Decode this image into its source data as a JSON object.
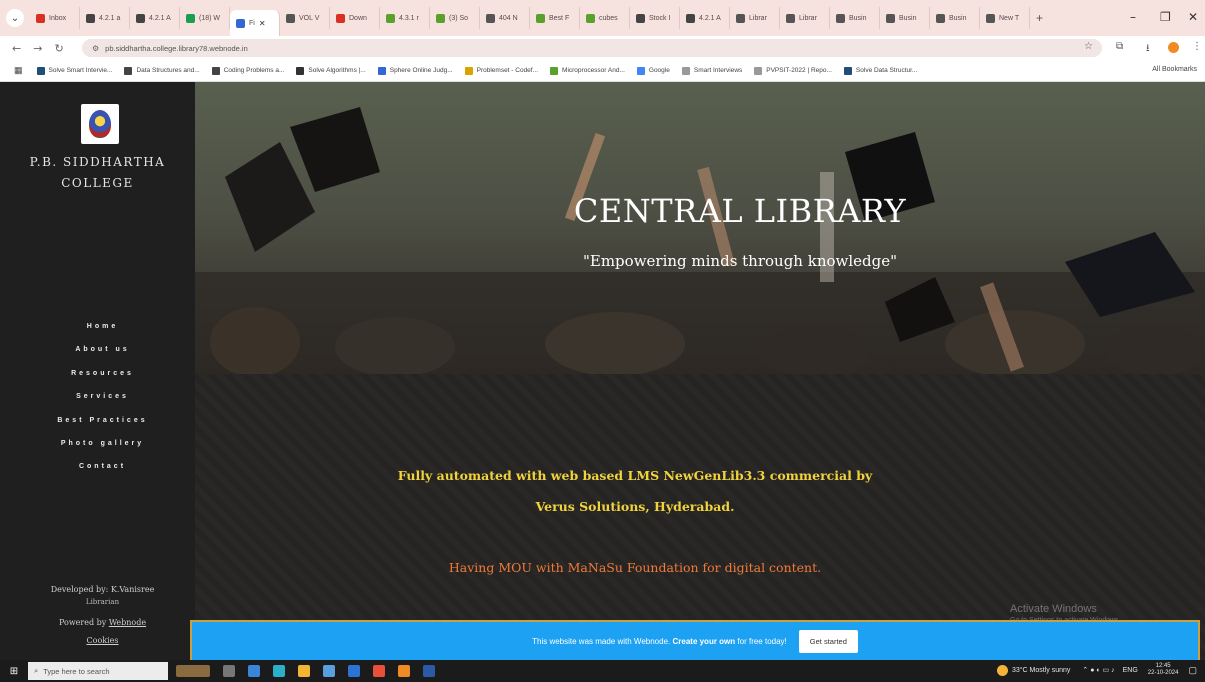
{
  "browser": {
    "tabs": [
      {
        "label": "Inbox",
        "color": "#d93025"
      },
      {
        "label": "4.2.1 a",
        "color": "#444444"
      },
      {
        "label": "4.2.1 A",
        "color": "#444444"
      },
      {
        "label": "(18) W",
        "color": "#1a9e50"
      },
      {
        "label": "Fi",
        "color": "#3367d6",
        "active": true
      },
      {
        "label": "VOL V",
        "color": "#555555"
      },
      {
        "label": "Down",
        "color": "#d93025"
      },
      {
        "label": "4.3.1 r",
        "color": "#5aa02c"
      },
      {
        "label": "(3) So",
        "color": "#5aa02c"
      },
      {
        "label": "404 N",
        "color": "#555555"
      },
      {
        "label": "Best F",
        "color": "#5aa02c"
      },
      {
        "label": "cubes",
        "color": "#5aa02c"
      },
      {
        "label": "Stock I",
        "color": "#444444"
      },
      {
        "label": "4.2.1 A",
        "color": "#444444"
      },
      {
        "label": "Librar",
        "color": "#555555"
      },
      {
        "label": "Librar",
        "color": "#555555"
      },
      {
        "label": "Busin",
        "color": "#555555"
      },
      {
        "label": "Busin",
        "color": "#555555"
      },
      {
        "label": "Busin",
        "color": "#555555"
      },
      {
        "label": "New T",
        "color": "#555555"
      }
    ],
    "url": "pb.siddhartha.college.library78.webnode.in",
    "bookmarks": [
      {
        "label": "Solve Smart Intervie...",
        "color": "#1f4e79"
      },
      {
        "label": "Data Structures and...",
        "color": "#444444"
      },
      {
        "label": "Coding Problems a...",
        "color": "#444444"
      },
      {
        "label": "Solve Algorithms |...",
        "color": "#333333"
      },
      {
        "label": "Sphere Online Judg...",
        "color": "#3367d6"
      },
      {
        "label": "Problemset - Codef...",
        "color": "#d9a400"
      },
      {
        "label": "Microprocessor And...",
        "color": "#5aa02c"
      },
      {
        "label": "Google",
        "color": "#4285f4"
      },
      {
        "label": "Smart Interviews",
        "color": "#999999"
      },
      {
        "label": "PVPSIT-2022 | Repo...",
        "color": "#999999"
      },
      {
        "label": "Solve Data Structur...",
        "color": "#1f4e79"
      }
    ],
    "all_bookmarks": "All Bookmarks"
  },
  "sidebar": {
    "college_line1": "P.B. SIDDHARTHA",
    "college_line2": "COLLEGE",
    "nav": [
      "Home",
      "About us",
      "Resources",
      "Services",
      "Best Practices",
      "Photo gallery",
      "Contact"
    ],
    "developer": "Developed by: K.Vanisree",
    "developer_role": "Librarian",
    "powered_prefix": "Powered by",
    "powered_link": "Webnode",
    "cookies": "Cookies"
  },
  "hero": {
    "title": "CENTRAL LIBRARY",
    "subtitle": "\"Empowering minds through knowledge\""
  },
  "content": {
    "line1": "Fully automated with web based LMS NewGenLib3.3 commercial by",
    "line2": "Verus Solutions, Hyderabad.",
    "line3": "Having MOU with MaNaSu Foundation for digital content."
  },
  "watermark": {
    "title": "Activate Windows",
    "sub": "Go to Settings to activate Windows."
  },
  "banner": {
    "text_prefix": "This website was made with Webnode.",
    "text_bold": "Create your own",
    "text_suffix": "for free today!",
    "button": "Get started"
  },
  "taskbar": {
    "search_placeholder": "Type here to search",
    "weather": "33°C  Mostly sunny",
    "lang": "ENG",
    "time": "12:45",
    "date": "22-10-2024"
  }
}
